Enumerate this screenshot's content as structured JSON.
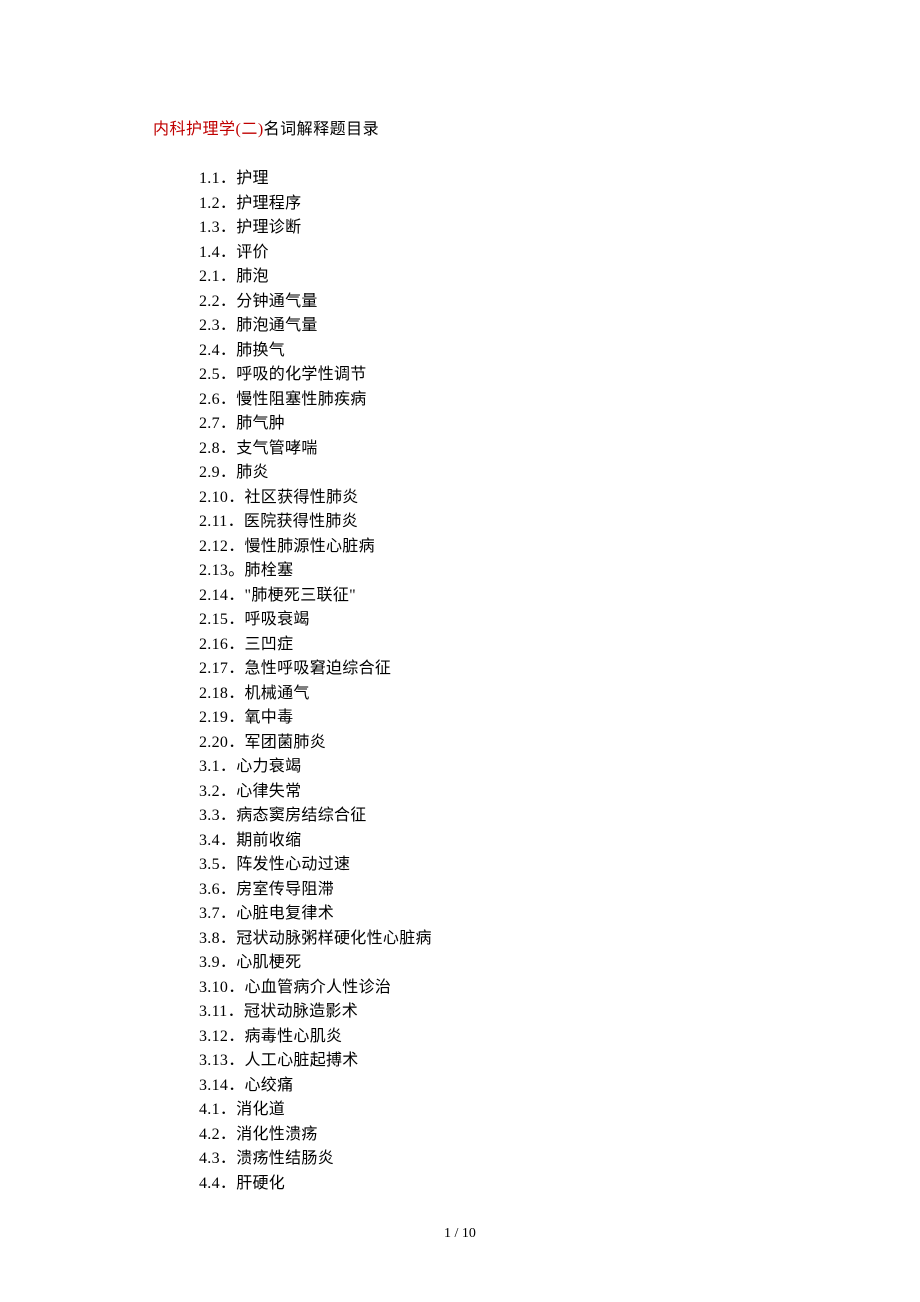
{
  "title_red": "内科护理学(二)",
  "title_black": "名词解释题目录",
  "items": [
    "1.1．护理",
    "1.2．护理程序",
    "1.3．护理诊断",
    "1.4．评价",
    "2.1．肺泡",
    "2.2．分钟通气量",
    "2.3．肺泡通气量",
    "2.4．肺换气",
    "2.5．呼吸的化学性调节",
    "2.6．慢性阻塞性肺疾病",
    "2.7．肺气肿",
    "2.8．支气管哮喘",
    "2.9．肺炎",
    "2.10．社区获得性肺炎",
    "2.11．医院获得性肺炎",
    "2.12．慢性肺源性心脏病",
    "2.13。肺栓塞",
    "2.14．\"肺梗死三联征\"",
    "2.15．呼吸衰竭",
    "2.16．三凹症",
    "2.17．急性呼吸窘迫综合征",
    "2.18．机械通气",
    "2.19．氧中毒",
    "2.20．军团菌肺炎",
    "3.1．心力衰竭",
    "3.2．心律失常",
    "3.3．病态窦房结综合征",
    "3.4．期前收缩",
    "3.5．阵发性心动过速",
    "3.6．房室传导阻滞",
    "3.7．心脏电复律术",
    "3.8．冠状动脉粥样硬化性心脏病",
    "3.9．心肌梗死",
    "3.10．心血管病介人性诊治",
    "3.11．冠状动脉造影术",
    "3.12．病毒性心肌炎",
    "3.13．人工心脏起搏术",
    "3.14．心绞痛",
    "4.1．消化道",
    "4.2．消化性溃疡",
    "4.3．溃疡性结肠炎",
    "4.4．肝硬化"
  ],
  "footer": "1 / 10"
}
